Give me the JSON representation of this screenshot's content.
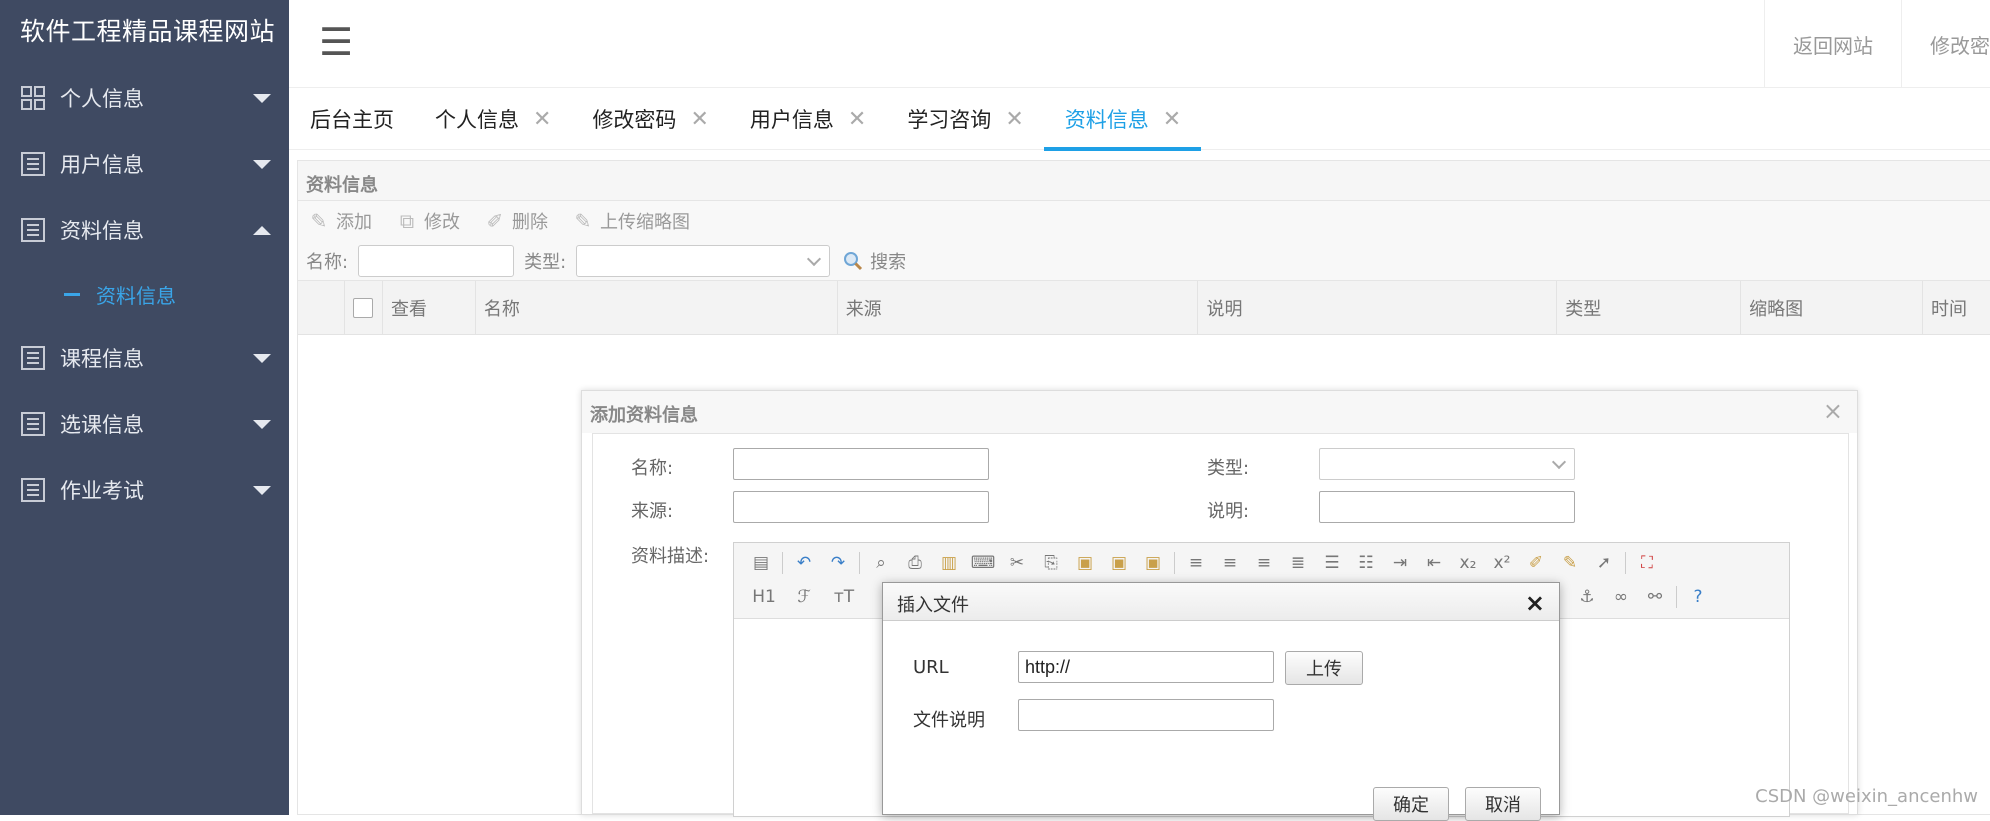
{
  "sidebar": {
    "brand": "软件工程精品课程网站",
    "items": [
      {
        "label": "个人信息",
        "icon": "grid-icon",
        "expanded": false
      },
      {
        "label": "用户信息",
        "icon": "list-icon",
        "expanded": false
      },
      {
        "label": "资料信息",
        "icon": "list-icon",
        "expanded": true
      },
      {
        "label": "课程信息",
        "icon": "list-icon",
        "expanded": false
      },
      {
        "label": "选课信息",
        "icon": "list-icon",
        "expanded": false
      },
      {
        "label": "作业考试",
        "icon": "list-icon",
        "expanded": false
      }
    ],
    "sub_item": "资料信息"
  },
  "topbar": {
    "hamburger": "☰",
    "links": [
      "返回网站",
      "修改密"
    ]
  },
  "tabs": [
    {
      "label": "后台主页",
      "closable": false
    },
    {
      "label": "个人信息",
      "closable": true
    },
    {
      "label": "修改密码",
      "closable": true
    },
    {
      "label": "用户信息",
      "closable": true
    },
    {
      "label": "学习咨询",
      "closable": true
    },
    {
      "label": "资料信息",
      "closable": true,
      "active": true
    }
  ],
  "panel": {
    "title": "资料信息",
    "toolbar": [
      "添加",
      "修改",
      "删除",
      "上传缩略图"
    ],
    "search": {
      "name_label": "名称:",
      "type_label": "类型:",
      "search_label": "搜索"
    },
    "columns": [
      "查看",
      "名称",
      "来源",
      "说明",
      "类型",
      "缩略图",
      "时间"
    ]
  },
  "add_dialog": {
    "title": "添加资料信息",
    "close": "×",
    "name_label": "名称:",
    "type_label": "类型:",
    "source_label": "来源:",
    "desc_label": "说明:",
    "content_label": "资料描述:",
    "editor_row2": [
      "H1",
      "ℱ",
      "ᴛT"
    ]
  },
  "insert_file_dialog": {
    "title": "插入文件",
    "close": "×",
    "url_label": "URL",
    "url_value": "http://",
    "upload": "上传",
    "file_desc_label": "文件说明",
    "file_desc_value": "",
    "confirm": "确定",
    "cancel": "取消"
  },
  "watermark": "CSDN @weixin_ancenhw",
  "colors": {
    "sidebar_bg": "#3f4a62",
    "accent": "#1ea0e6"
  }
}
